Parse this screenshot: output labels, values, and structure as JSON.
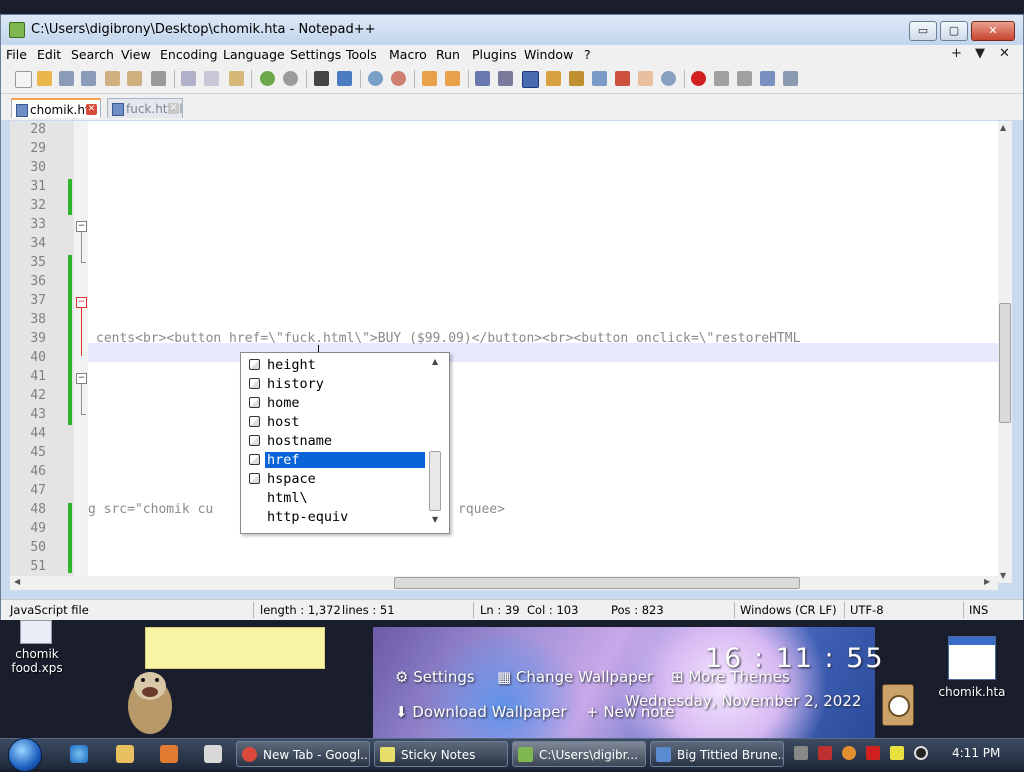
{
  "window": {
    "title": "C:\\Users\\digibrony\\Desktop\\chomik.hta - Notepad++",
    "minimize": "▭",
    "maximize": "▢",
    "close": "✕"
  },
  "menu": [
    "File",
    "Edit",
    "Search",
    "View",
    "Encoding",
    "Language",
    "Settings",
    "Tools",
    "Macro",
    "Run",
    "Plugins",
    "Window",
    "?"
  ],
  "menu_right": [
    "+",
    "▼",
    "✕"
  ],
  "tabs": [
    {
      "label": "chomik.hta",
      "active": true
    },
    {
      "label": "fuck.html",
      "active": false
    }
  ],
  "editor": {
    "line_numbers": [
      "28",
      "29",
      "30",
      "31",
      "32",
      "33",
      "34",
      "35",
      "36",
      "37",
      "38",
      "39",
      "40",
      "41",
      "42",
      "43",
      "44",
      "45",
      "46",
      "47",
      "48",
      "49",
      "50",
      "51"
    ],
    "line39_text": "cents<br><button href=\\\"fuck.html\\\">BUY ($99.09)</button><br><button onclick=\\\"restoreHTML",
    "line48_left": "g src=\"chomik cu",
    "line48_right": "rquee>",
    "current_line": "39"
  },
  "autocomplete": {
    "items": [
      "height",
      "history",
      "home",
      "host",
      "hostname",
      "href",
      "hspace",
      "html\\",
      "http-equiv"
    ],
    "selected": "href"
  },
  "statusbar": {
    "file_type": "JavaScript file",
    "length": "length : 1,372",
    "lines": "lines : 51",
    "ln": "Ln : 39",
    "col": "Col : 103",
    "pos": "Pos : 823",
    "eol": "Windows (CR LF)",
    "encoding": "UTF-8",
    "mode": "INS"
  },
  "desktop": {
    "icons": [
      {
        "label_line1": "chomik",
        "label_line2": "food.xps"
      },
      {
        "label_line1": "chomik.hta",
        "label_line2": ""
      }
    ],
    "gadget": {
      "settings": "Settings",
      "change_wallpaper": "Change Wallpaper",
      "more_themes": "More Themes",
      "download_wallpaper": "Download Wallpaper",
      "new_note": "+ New note",
      "clock": "16 : 11 : 55",
      "date": "Wednesday, November 2, 2022"
    }
  },
  "taskbar": {
    "tasks": [
      {
        "label": "New Tab - Googl...",
        "icon_color": "#d94a3a"
      },
      {
        "label": "Sticky Notes",
        "icon_color": "#e8df6a"
      },
      {
        "label": "C:\\Users\\digibr...",
        "icon_color": "#7fb650"
      },
      {
        "label": "Big Tittied Brune...",
        "icon_color": "#5a8ad0"
      }
    ],
    "time": "4:11 PM"
  },
  "colors": {
    "accent_selection": "#0a64d8",
    "change_bar": "#2db52d",
    "current_line": "#e8e8ff"
  }
}
